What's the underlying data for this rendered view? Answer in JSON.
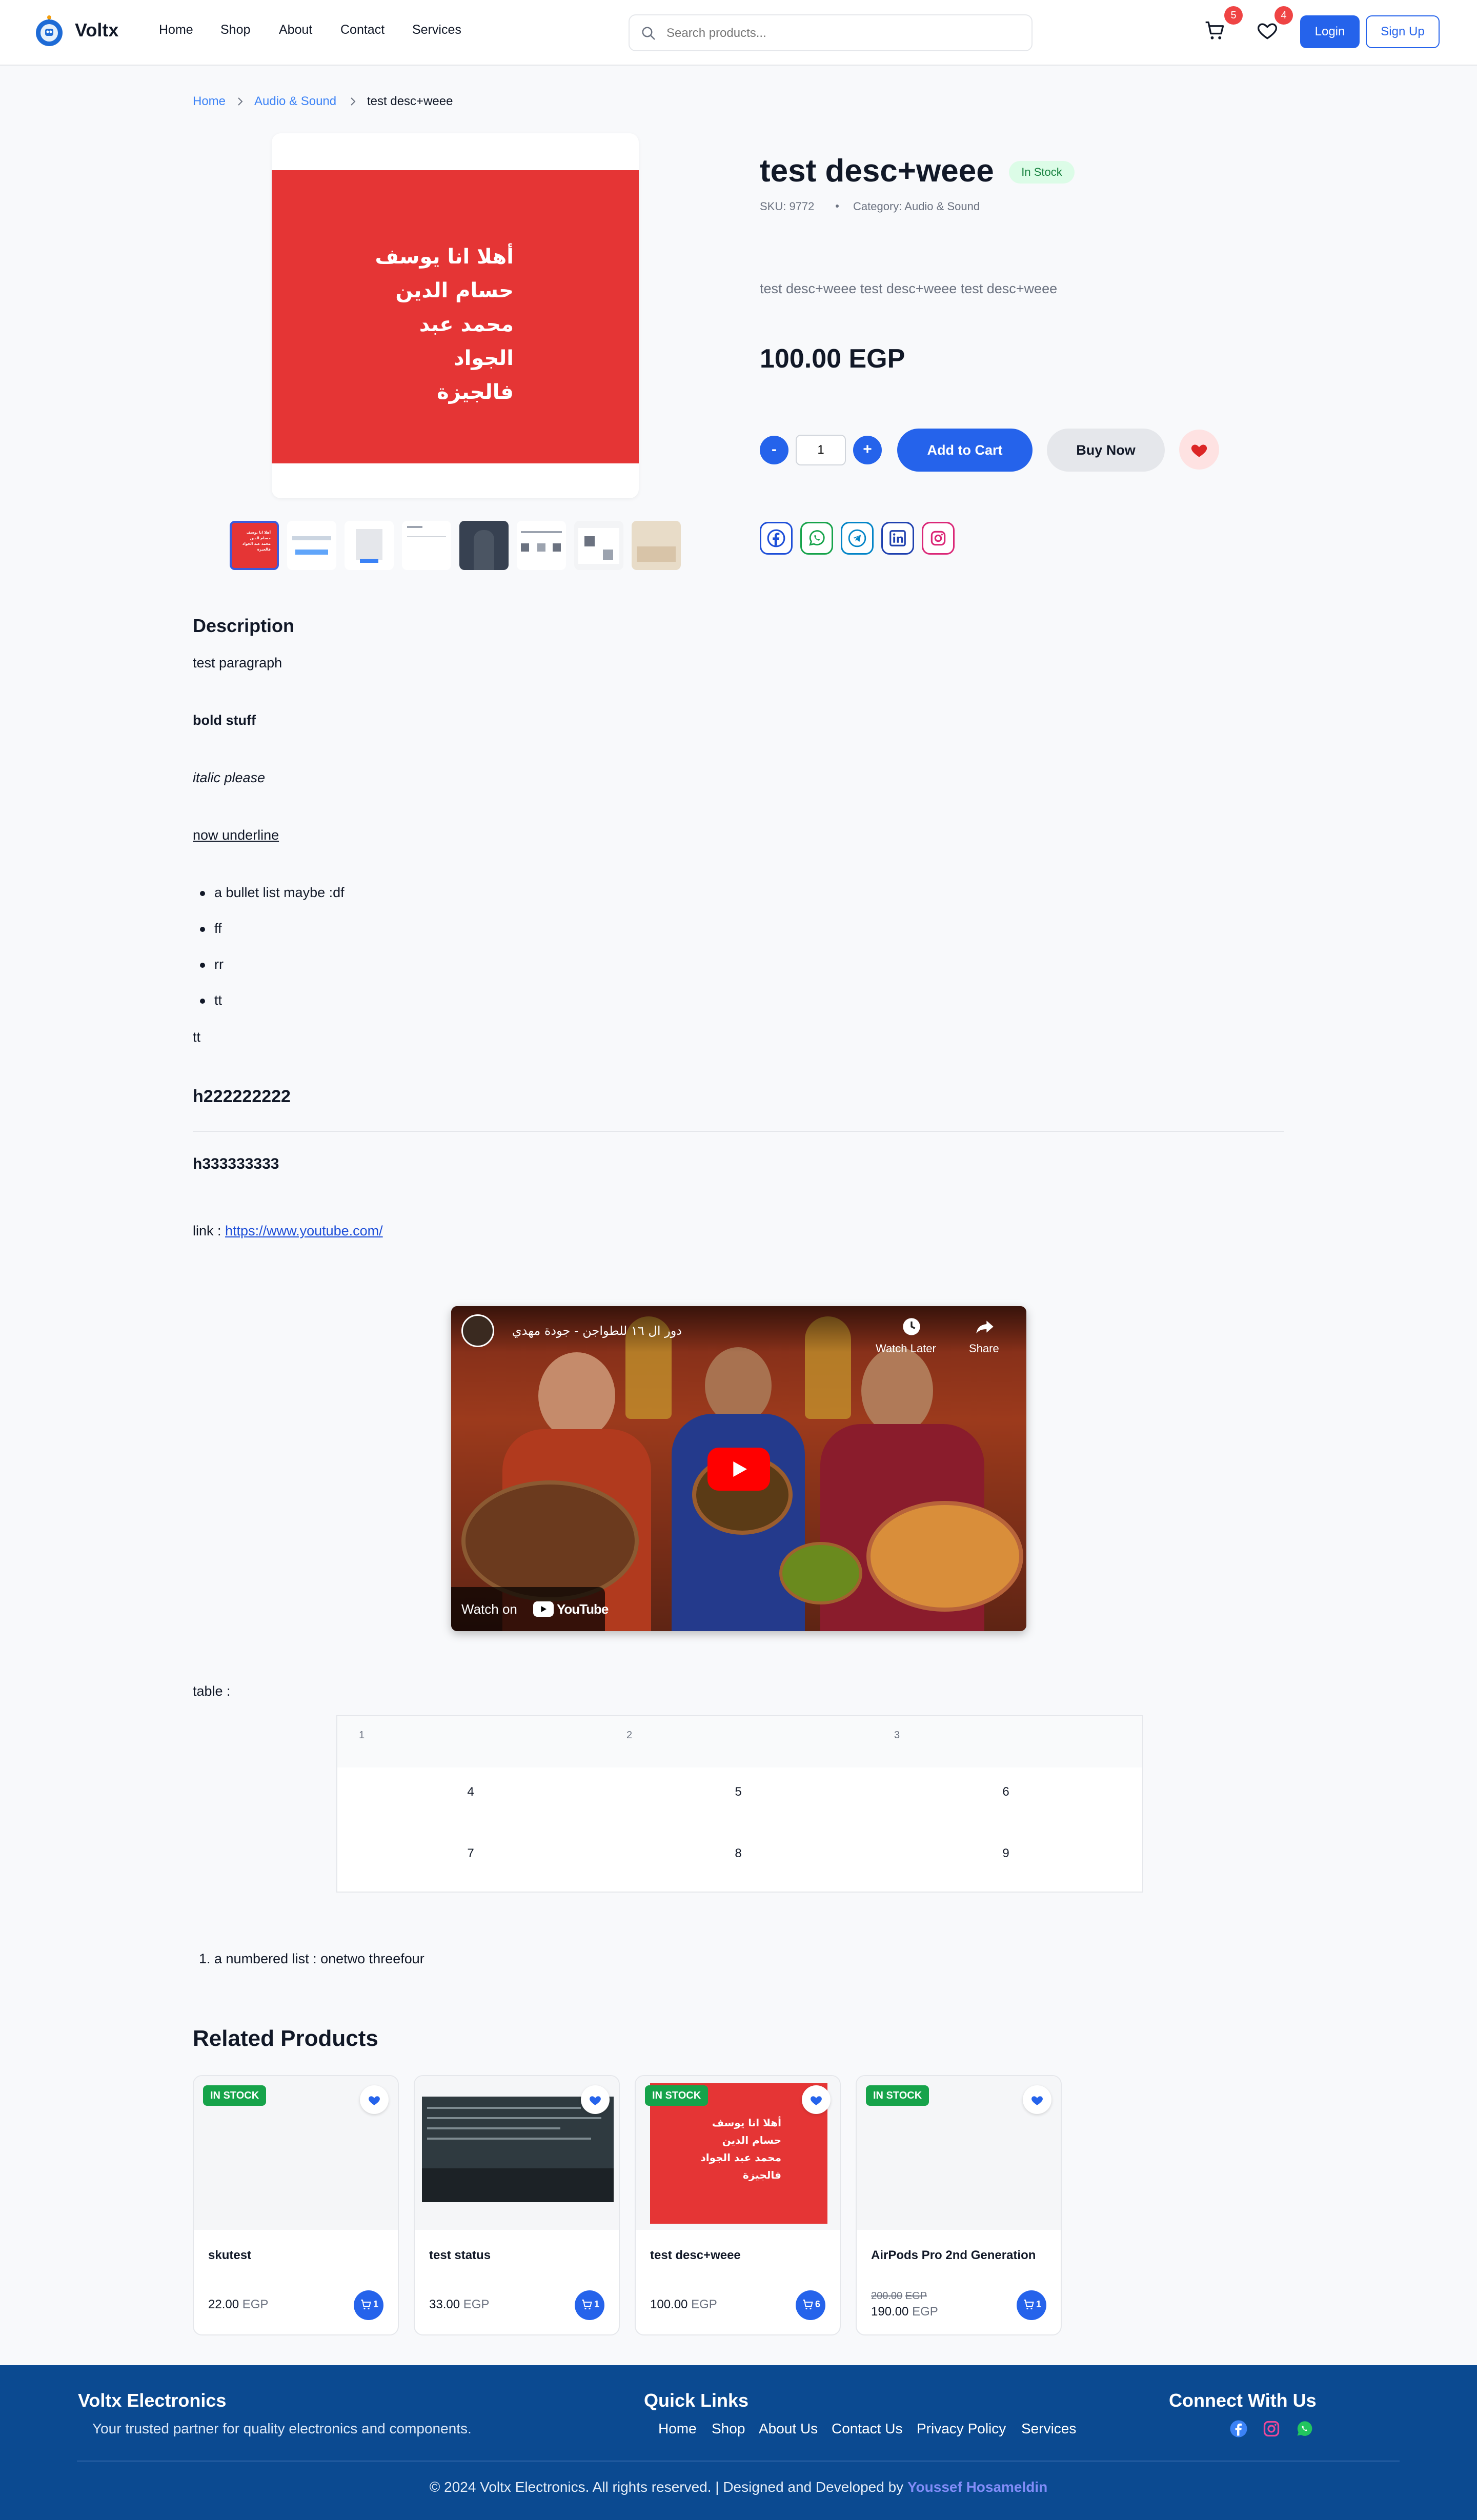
{
  "header": {
    "brand": "Voltx",
    "nav": [
      "Home",
      "Shop",
      "About",
      "Contact",
      "Services"
    ],
    "search_placeholder": "Search products...",
    "cart_count": "5",
    "wishlist_count": "4",
    "login": "Login",
    "signup": "Sign Up"
  },
  "breadcrumb": {
    "home": "Home",
    "category": "Audio & Sound",
    "current": "test desc+weee"
  },
  "product": {
    "title": "test desc+weee",
    "stock": "In Stock",
    "sku": "SKU: 9772",
    "category": "Category: Audio & Sound",
    "short_description": "test desc+weee test desc+weee test desc+weee",
    "price": "100.00 EGP",
    "image_text": "أهلا انا يوسف\nحسام الدين\nمحمد عبد الجواد\nفالجيزة",
    "quantity": "1",
    "minus": "-",
    "plus": "+",
    "add_to_cart": "Add to Cart",
    "buy_now": "Buy Now"
  },
  "description": {
    "heading": "Description",
    "paragraph": "test paragraph",
    "bold": "bold stuff",
    "italic": "italic please",
    "underline": "now underline",
    "bullets": [
      "a bullet list maybe :df",
      "ff",
      "rr",
      "tt"
    ],
    "after_list": "tt",
    "h2": "h222222222",
    "h3": "h333333333",
    "link_label": "link : ",
    "link_url": "https://www.youtube.com/",
    "video": {
      "title": "دور ال ١٦ للطواجن - جودة مهدي",
      "watch_later": "Watch Later",
      "share": "Share",
      "watch_on": "Watch on",
      "youtube": "YouTube"
    },
    "table_label": "table :",
    "table_head": [
      "1",
      "2",
      "3"
    ],
    "table_rows": [
      [
        "4",
        "5",
        "6"
      ],
      [
        "7",
        "8",
        "9"
      ]
    ],
    "numbered_item": "1. a numbered list : onetwo threefour"
  },
  "related": {
    "heading": "Related Products",
    "stock_label": "IN STOCK",
    "currency": "EGP",
    "items": [
      {
        "name": "skutest",
        "price": "22.00",
        "cart_count": "1"
      },
      {
        "name": "test status",
        "price": "33.00",
        "cart_count": "1"
      },
      {
        "name": "test desc+weee",
        "price": "100.00",
        "cart_count": "6"
      },
      {
        "name": "AirPods Pro 2nd Generation",
        "old_price": "200.00",
        "price": "190.00",
        "cart_count": "1"
      }
    ]
  },
  "footer": {
    "brand_heading": "Voltx Electronics",
    "tagline": "Your trusted partner for quality electronics and components.",
    "quick_links_heading": "Quick Links",
    "links": [
      "Home",
      "Shop",
      "About Us",
      "Contact Us",
      "Privacy Policy",
      "Services"
    ],
    "connect_heading": "Connect With Us",
    "copyright": "© 2024 Voltx Electronics. All rights reserved. | Designed and Developed by ",
    "developer": "Youssef Hosameldin"
  },
  "colors": {
    "primary": "#2563eb",
    "danger": "#ef4444",
    "success": "#16a34a",
    "footer": "#0b4a91",
    "product_image": "#e53535"
  }
}
